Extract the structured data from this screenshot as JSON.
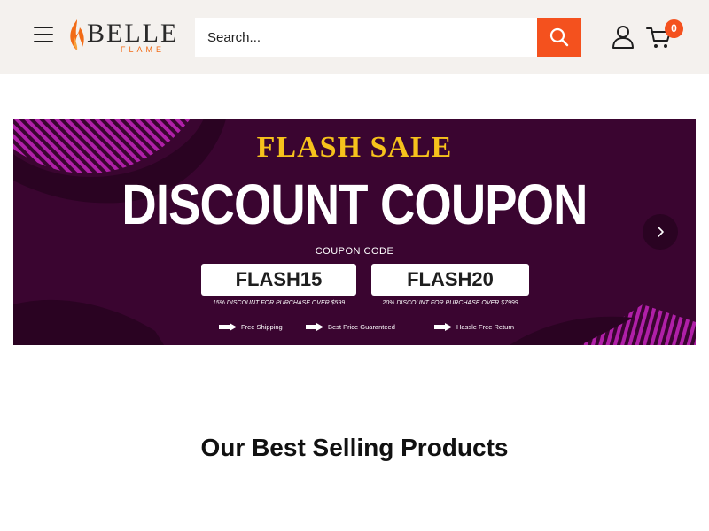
{
  "header": {
    "logo": {
      "name": "BELLE",
      "sub": "FLAME"
    },
    "search": {
      "placeholder": "Search..."
    },
    "cart": {
      "count": "0"
    },
    "colors": {
      "accent": "#f4511e",
      "header_bg": "#f4f1ee"
    }
  },
  "banner": {
    "headline": "FLASH SALE",
    "title": "DISCOUNT COUPON",
    "coupon_label": "COUPON CODE",
    "codes": [
      {
        "code": "FLASH15",
        "desc": "15% DISCOUNT FOR PURCHASE OVER $599"
      },
      {
        "code": "FLASH20",
        "desc": "20% DISCOUNT FOR PURCHASE OVER $7999"
      }
    ],
    "features": [
      "Free Shipping",
      "Best Price Guaranteed",
      "Hassle Free Return"
    ],
    "colors": {
      "bg": "#3a0530",
      "headline": "#f6c21c",
      "stripes": "#b01fa8"
    }
  },
  "section": {
    "title": "Our Best Selling Products"
  }
}
